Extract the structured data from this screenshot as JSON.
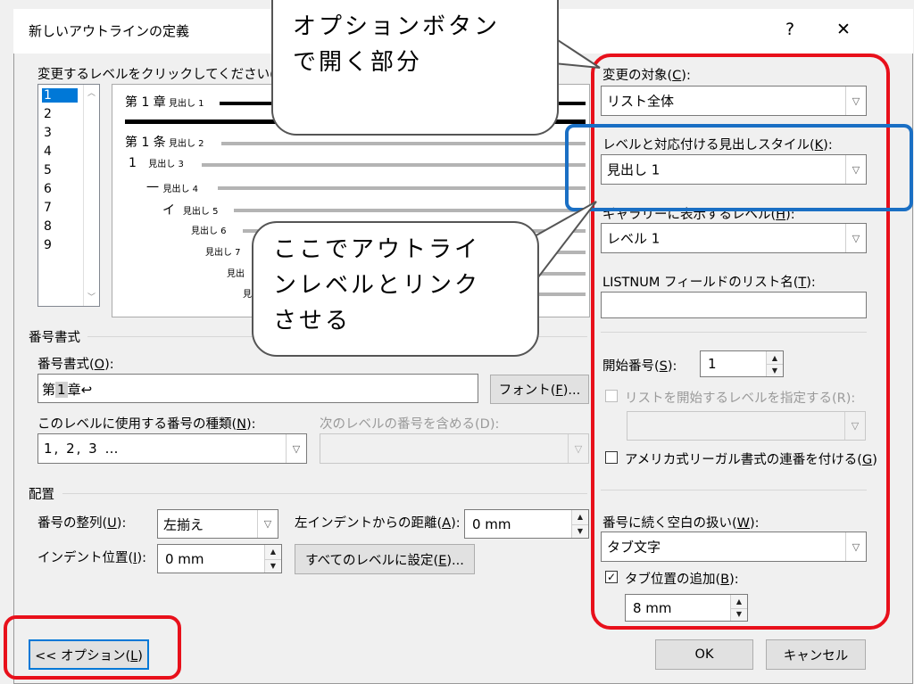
{
  "dialog": {
    "title": "新しいアウトラインの定義",
    "help_glyph": "?",
    "close_glyph": "✕"
  },
  "levels": {
    "label": "変更するレベルをクリックしてください(V):",
    "items": [
      "1",
      "2",
      "3",
      "4",
      "5",
      "6",
      "7",
      "8",
      "9"
    ],
    "selected": "1"
  },
  "preview": {
    "lines": [
      {
        "num": "第 1 章",
        "suffix": "見出し 1"
      },
      {
        "num": "第 1 条",
        "suffix": "見出し 2"
      },
      {
        "num": "1",
        "suffix": "見出し 3"
      },
      {
        "num": "一",
        "suffix": "見出し 4"
      },
      {
        "num": "イ",
        "suffix": "見出し 5"
      },
      {
        "num": "",
        "suffix": "見出し 6"
      },
      {
        "num": "",
        "suffix": "見出し 7"
      },
      {
        "num": "",
        "suffix": "見出"
      },
      {
        "num": "",
        "suffix": "見"
      }
    ]
  },
  "number_format": {
    "section": "番号書式",
    "format_label": "番号書式(O):",
    "format_value": {
      "pre": "第",
      "num": "1",
      "post": "章↩"
    },
    "font_button": "フォント(F)...",
    "style_label": "このレベルに使用する番号の種類(N):",
    "style_value": "1, 2, 3 …",
    "include_label": "次のレベルの番号を含める(D):",
    "include_value": ""
  },
  "position": {
    "section": "配置",
    "align_label": "番号の整列(U):",
    "align_value": "左揃え",
    "left_indent_label": "左インデントからの距離(A):",
    "left_indent_value": "0 mm",
    "indent_label": "インデント位置(I):",
    "indent_value": "0 mm",
    "set_all_button": "すべてのレベルに設定(E)..."
  },
  "right_panel": {
    "apply_to_label": "変更の対象(C):",
    "apply_to_value": "リスト全体",
    "link_style_label": "レベルと対応付ける見出しスタイル(K):",
    "link_style_value": "見出し 1",
    "gallery_level_label": "ギャラリーに表示するレベル(H):",
    "gallery_level_value": "レベル 1",
    "listnum_label": "LISTNUM フィールドのリスト名(T):",
    "listnum_value": "",
    "start_at_label": "開始番号(S):",
    "start_at_value": "1",
    "restart_label": "リストを開始するレベルを指定する(R):",
    "restart_value": "",
    "legal_label": "アメリカ式リーガル書式の連番を付ける(G)",
    "legal_checked": false,
    "follow_label": "番号に続く空白の扱い(W):",
    "follow_value": "タブ文字",
    "tab_add_label": "タブ位置の追加(B):",
    "tab_add_checked": true,
    "tab_add_value": "8 mm"
  },
  "footer": {
    "options_button": "<< オプション(L)",
    "ok_button": "OK",
    "cancel_button": "キャンセル"
  },
  "annotations": {
    "callout_options": [
      "オプションボタン",
      "で開く部分"
    ],
    "callout_link": [
      "ここでアウトライ",
      "ンレベルとリンク",
      "させる"
    ],
    "red_color": "#e8101b",
    "blue_color": "#1a6fc4"
  }
}
